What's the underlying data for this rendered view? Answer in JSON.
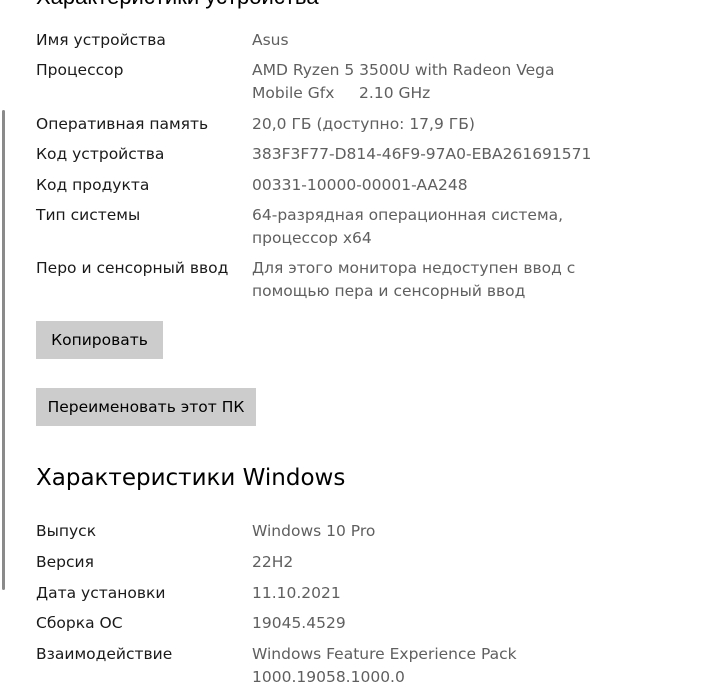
{
  "device_section": {
    "title_partial": "Характеристики устройства",
    "rows": [
      {
        "label": "Имя устройства",
        "value": "Asus"
      },
      {
        "label": "Процессор",
        "value_lines": [
          "AMD Ryzen 5 3500U with Radeon Vega",
          "Mobile Gfx     2.10 GHz"
        ]
      },
      {
        "label": "Оперативная память",
        "value": "20,0 ГБ (доступно: 17,9 ГБ)"
      },
      {
        "label": "Код устройства",
        "value": "383F3F77-D814-46F9-97A0-EBA261691571"
      },
      {
        "label": "Код продукта",
        "value": "00331-10000-00001-AA248"
      },
      {
        "label": "Тип системы",
        "value_lines": [
          "64-разрядная операционная система,",
          "процессор x64"
        ]
      },
      {
        "label": "Перо и сенсорный ввод",
        "value_lines": [
          "Для этого монитора недоступен ввод с",
          "помощью пера и сенсорный ввод"
        ]
      }
    ],
    "copy_button": "Копировать",
    "rename_button": "Переименовать этот ПК"
  },
  "windows_section": {
    "title": "Характеристики Windows",
    "rows": [
      {
        "label": "Выпуск",
        "value": "Windows 10 Pro"
      },
      {
        "label": "Версия",
        "value": "22H2"
      },
      {
        "label": "Дата установки",
        "value": "11.10.2021"
      },
      {
        "label": "Сборка ОС",
        "value": "19045.4529"
      },
      {
        "label": "Взаимодействие",
        "value_lines": [
          "Windows Feature Experience Pack",
          "1000.19058.1000.0"
        ]
      }
    ]
  }
}
